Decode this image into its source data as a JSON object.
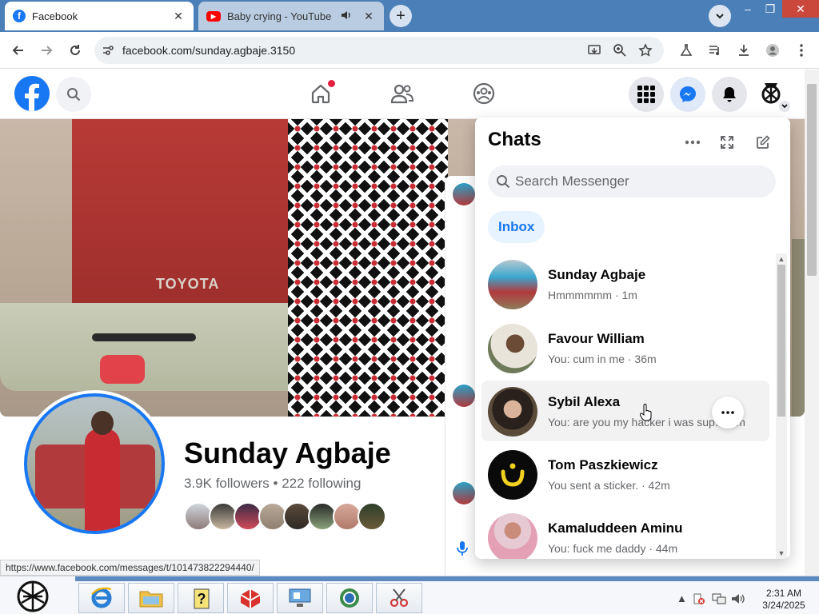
{
  "browser": {
    "tabs": [
      {
        "title": "Facebook",
        "active": true,
        "icon": "facebook-favicon"
      },
      {
        "title": "Baby crying - YouTube",
        "active": false,
        "icon": "youtube-favicon",
        "audio": true
      }
    ],
    "new_tab_symbol": "+",
    "address": "facebook.com/sunday.agbaje.3150",
    "status_url": "https://www.facebook.com/messages/t/101473822294440/"
  },
  "profile": {
    "name": "Sunday Agbaje",
    "followers": "3.9K followers",
    "separator": "•",
    "following": "222 following",
    "cover_text": "TOYOTA"
  },
  "chats": {
    "title": "Chats",
    "search_placeholder": "Search Messenger",
    "filter": "Inbox",
    "items": [
      {
        "name": "Sunday Agbaje",
        "preview": "Hmmmmmm · 1m"
      },
      {
        "name": "Favour William",
        "preview": "You: cum in me · 36m"
      },
      {
        "name": "Sybil Alexa",
        "preview": "You: are you my hacker i was sup… · m"
      },
      {
        "name": "Tom Paszkiewicz",
        "preview": "You sent a sticker. · 42m"
      },
      {
        "name": "Kamaluddeen Aminu",
        "preview": "You: fuck me daddy · 44m"
      }
    ]
  },
  "taskbar": {
    "time": "2:31 AM",
    "date": "3/24/2025"
  },
  "colors": {
    "fb_blue": "#1877f2",
    "notification_red": "#e41e3f",
    "tabbar": "#4a7fb8"
  }
}
